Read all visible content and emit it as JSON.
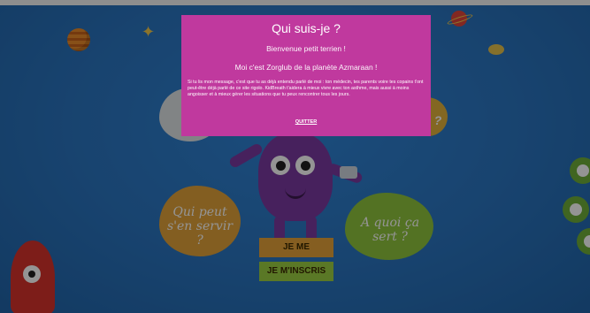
{
  "modal": {
    "title": "Qui suis-je ?",
    "subtitle_1": "Bienvenue petit terrien !",
    "subtitle_2": "Moi c'est Zorglub de la planète Azmaraan !",
    "body": "Si tu lis mon message, c'est que tu as déjà entendu parlé de moi : ton médecin, tes parents voire tes copains t'ont peut-être déjà parlé de ce site rigolo. KidBreath t'aidera à mieux vivre avec ton asthme, mais aussi à moins angoisser et à mieux gérer les situations que tu peux rencontrer tous les jours.",
    "quit_label": "QUITTER"
  },
  "bubbles": {
    "orange_text": "Qui peut s'en servir ?",
    "green_text": "A quoi ça sert ?",
    "yellow_text": "?"
  },
  "buttons": {
    "connect_label": "JE ME CONNECTE",
    "signup_label": "JE M'INSCRIS"
  },
  "icons": {
    "planet_orange": "planet-icon",
    "planet_red": "ringed-planet-icon",
    "rocket": "rocket-icon",
    "saturn": "saturn-icon"
  },
  "colors": {
    "background": "#2b78c4",
    "modal": "#c0399e",
    "connect_button": "#e6a23a",
    "signup_button": "#9ccf43",
    "monster": "#7a3aa0"
  }
}
